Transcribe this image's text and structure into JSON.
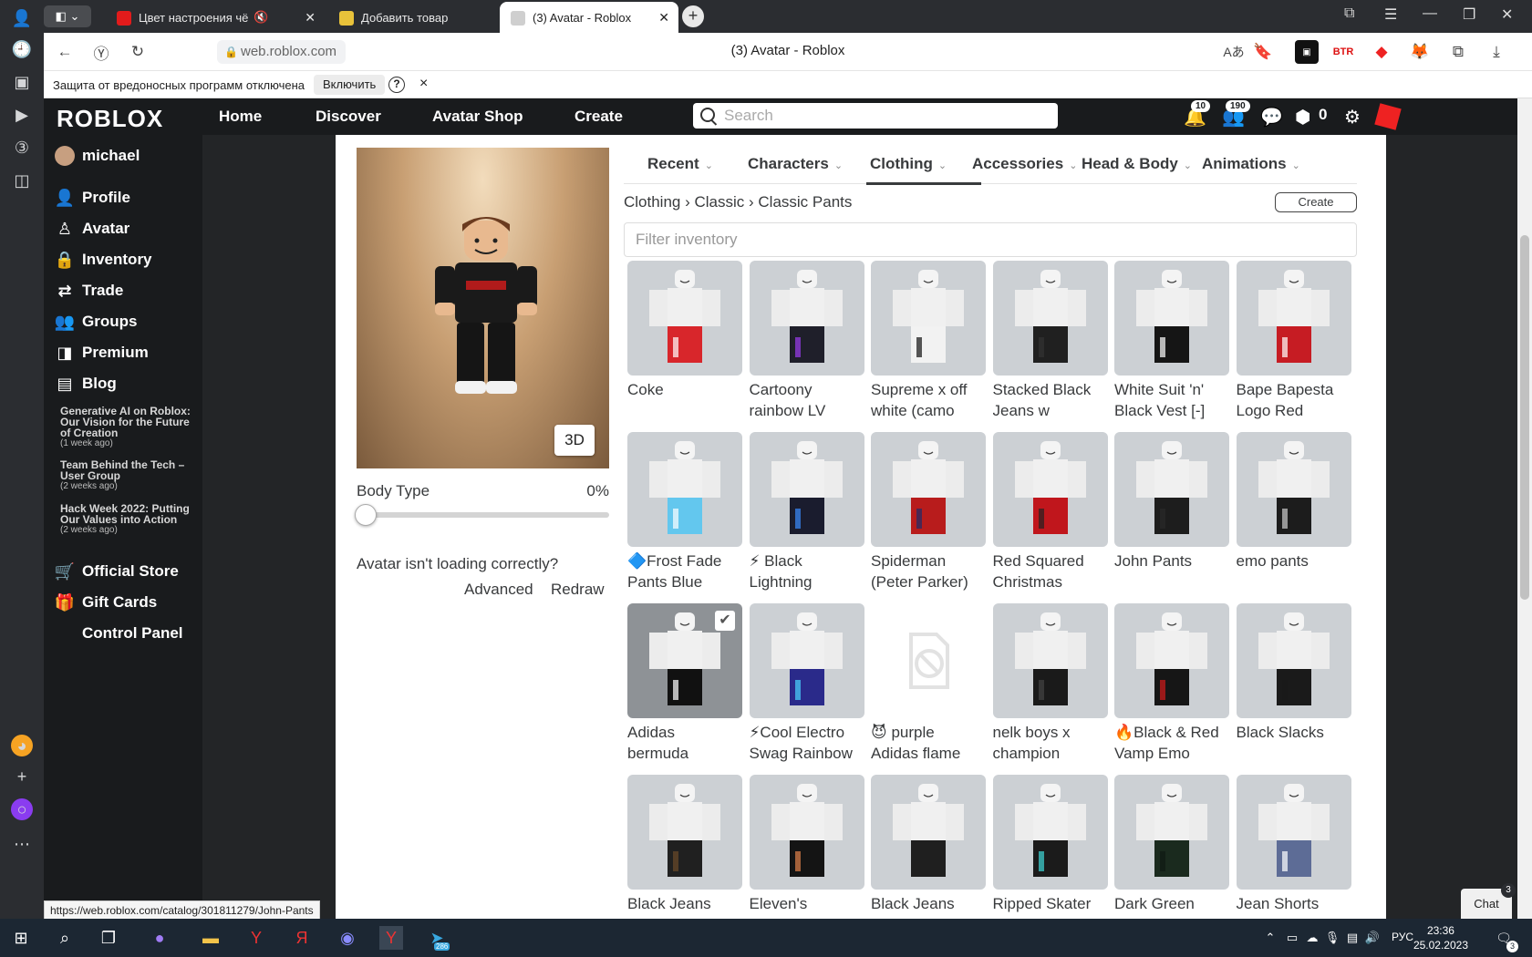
{
  "browser": {
    "tabs": [
      {
        "title": "Цвет настроения чё",
        "fav": "#e21b1b"
      },
      {
        "title": "Добавить товар",
        "fav": "#e8c23a"
      },
      {
        "title": "(3) Avatar - Roblox",
        "fav": "#cfcfcf"
      }
    ],
    "url": "web.roblox.com",
    "page_title": "(3) Avatar - Roblox",
    "infobar": {
      "text": "Защита от вредоносных программ отключена",
      "button": "Включить",
      "help": "?",
      "close": "×"
    },
    "status_url": "https://web.roblox.com/catalog/301811279/John-Pants"
  },
  "header": {
    "logo": "ROBLOX",
    "nav": [
      "Home",
      "Discover",
      "Avatar Shop",
      "Create"
    ],
    "search_placeholder": "Search",
    "notif_count": "10",
    "friends_count": "190",
    "robux": "0"
  },
  "sidebar": {
    "user": "michael",
    "items": [
      "Profile",
      "Avatar",
      "Inventory",
      "Trade",
      "Groups",
      "Premium",
      "Blog"
    ],
    "blog_posts": [
      {
        "title": "Generative AI on Roblox: Our Vision for the Future of Creation",
        "ago": "(1 week ago)"
      },
      {
        "title": "Team Behind the Tech – User Group",
        "ago": "(2 weeks ago)"
      },
      {
        "title": "Hack Week 2022: Putting Our Values into Action",
        "ago": "(2 weeks ago)"
      }
    ],
    "bottom_items": [
      "Official Store",
      "Gift Cards",
      "Control Panel"
    ]
  },
  "avatar": {
    "btn_3d": "3D",
    "body_type_label": "Body Type",
    "body_type_value": "0%",
    "body_type_fraction": 0,
    "loading_q": "Avatar isn't loading correctly?",
    "advanced": "Advanced",
    "redraw": "Redraw"
  },
  "tabs": [
    "Recent",
    "Characters",
    "Clothing",
    "Accessories",
    "Head & Body",
    "Animations"
  ],
  "breadcrumb": [
    "Clothing",
    "Classic",
    "Classic Pants"
  ],
  "create_btn": "Create",
  "filter_placeholder": "Filter inventory",
  "items": [
    {
      "l1": "Coke",
      "l2": "",
      "pants": "#d8262b",
      "acc": "#ffffff"
    },
    {
      "l1": "Cartoony",
      "l2": "rainbow LV",
      "pants": "#1f1f2a",
      "acc": "#9b3cf0"
    },
    {
      "l1": "Supreme x off",
      "l2": "white (camo",
      "pants": "#f2f2f2",
      "acc": "#111111"
    },
    {
      "l1": "Stacked Black",
      "l2": "Jeans w",
      "pants": "#202020",
      "acc": "#333333"
    },
    {
      "l1": "White Suit 'n'",
      "l2": "Black Vest [-]",
      "pants": "#151515",
      "acc": "#ffffff"
    },
    {
      "l1": "Bape Bapesta",
      "l2": "Logo Red",
      "pants": "#c61c23",
      "acc": "#ffffff"
    },
    {
      "l1": "🔷Frost Fade",
      "l2": "Pants Blue",
      "pants": "#63c7ee",
      "acc": "#ffffff"
    },
    {
      "l1": "⚡ Black",
      "l2": "Lightning",
      "pants": "#1a1c2e",
      "acc": "#3a8cff"
    },
    {
      "l1": "Spiderman",
      "l2": "(Peter Parker)",
      "pants": "#b81c1c",
      "acc": "#1b2c6b"
    },
    {
      "l1": "Red Squared",
      "l2": "Christmas",
      "pants": "#c0161c",
      "acc": "#222222"
    },
    {
      "l1": "John Pants",
      "l2": "",
      "pants": "#1d1d1d",
      "acc": "#2a2a2a"
    },
    {
      "l1": "emo pants",
      "l2": "",
      "pants": "#1c1c1c",
      "acc": "#cccccc"
    },
    {
      "l1": "Adidas",
      "l2": "bermuda",
      "pants": "#111111",
      "acc": "#ffffff"
    },
    {
      "l1": "⚡Cool Electro",
      "l2": "Swag Rainbow",
      "pants": "#2a2a8a",
      "acc": "#4ad6ff"
    },
    {
      "l1": "😈 purple",
      "l2": "Adidas flame",
      "pants": "",
      "acc": ""
    },
    {
      "l1": "nelk boys x",
      "l2": "champion",
      "pants": "#1a1a1a",
      "acc": "#444444"
    },
    {
      "l1": "🔥Black & Red",
      "l2": "Vamp Emo",
      "pants": "#161616",
      "acc": "#d31b1b"
    },
    {
      "l1": "Black Slacks",
      "l2": "",
      "pants": "#1a1a1a",
      "acc": "#1a1a1a"
    },
    {
      "l1": "Black Jeans",
      "l2": "",
      "pants": "#202020",
      "acc": "#6b4a2a"
    },
    {
      "l1": "Eleven's",
      "l2": "",
      "pants": "#141414",
      "acc": "#e0824a"
    },
    {
      "l1": "Black Jeans",
      "l2": "",
      "pants": "#1f1f1f",
      "acc": "#1f1f1f"
    },
    {
      "l1": "Ripped Skater",
      "l2": "",
      "pants": "#1b1b1b",
      "acc": "#3fd8d8"
    },
    {
      "l1": "Dark Green",
      "l2": "",
      "pants": "#1a2a1e",
      "acc": "#0f1a12"
    },
    {
      "l1": "Jean Shorts",
      "l2": "",
      "pants": "#5d6c96",
      "acc": "#ffffff"
    }
  ],
  "selected_index": 12,
  "chat": {
    "label": "Chat",
    "count": "3"
  },
  "taskbar": {
    "lang": "РУС",
    "time": "23:36",
    "date": "25.02.2023",
    "notif": "3",
    "tg_count": "286"
  }
}
